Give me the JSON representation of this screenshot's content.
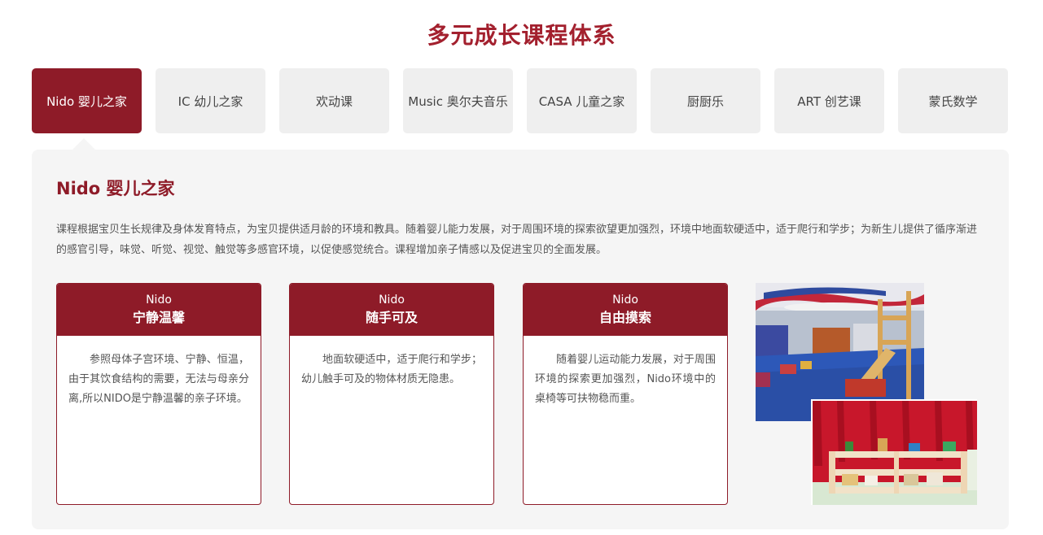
{
  "section_title": "多元成长课程体系",
  "tabs": [
    {
      "label": "Nido 婴儿之家",
      "active": true
    },
    {
      "label": "IC 幼儿之家",
      "active": false
    },
    {
      "label": "欢动课",
      "active": false
    },
    {
      "label": "Music 奥尔夫音乐",
      "active": false
    },
    {
      "label": "CASA 儿童之家",
      "active": false
    },
    {
      "label": "厨厨乐",
      "active": false
    },
    {
      "label": "ART 创艺课",
      "active": false
    },
    {
      "label": "蒙氏数学",
      "active": false
    }
  ],
  "panel": {
    "heading": "Nido 婴儿之家",
    "description": "课程根据宝贝生长规律及身体发育特点，为宝贝提供适月龄的环境和教具。随着婴儿能力发展，对于周围环境的探索欲望更加强烈，环境中地面软硬适中，适于爬行和学步；为新生儿提供了循序渐进的感官引导，味觉、听觉、视觉、触觉等多感官环境，以促使感觉统合。课程增加亲子情感以及促进宝贝的全面发展。",
    "cards": [
      {
        "subtitle": "Nido",
        "title": "宁静温馨",
        "body": "参照母体子宫环境、宁静、恒温，由于其饮食结构的需要，无法与母亲分离,所以NIDO是宁静温馨的亲子环境。"
      },
      {
        "subtitle": "Nido",
        "title": "随手可及",
        "body": "地面软硬适中，适于爬行和学步；幼儿触手可及的物体材质无隐患。"
      },
      {
        "subtitle": "Nido",
        "title": "自由摸索",
        "body": "随着婴儿运动能力发展，对于周围环境的探索更加强烈，Nido环境中的桌椅等可扶物稳而重。"
      }
    ]
  },
  "colors": {
    "brand": "#8e1b28",
    "title": "#a3202e",
    "tab_bg": "#efefef",
    "panel_bg": "#f5f5f5"
  },
  "images": [
    "nido-playroom-photo",
    "montessori-shelf-photo"
  ]
}
